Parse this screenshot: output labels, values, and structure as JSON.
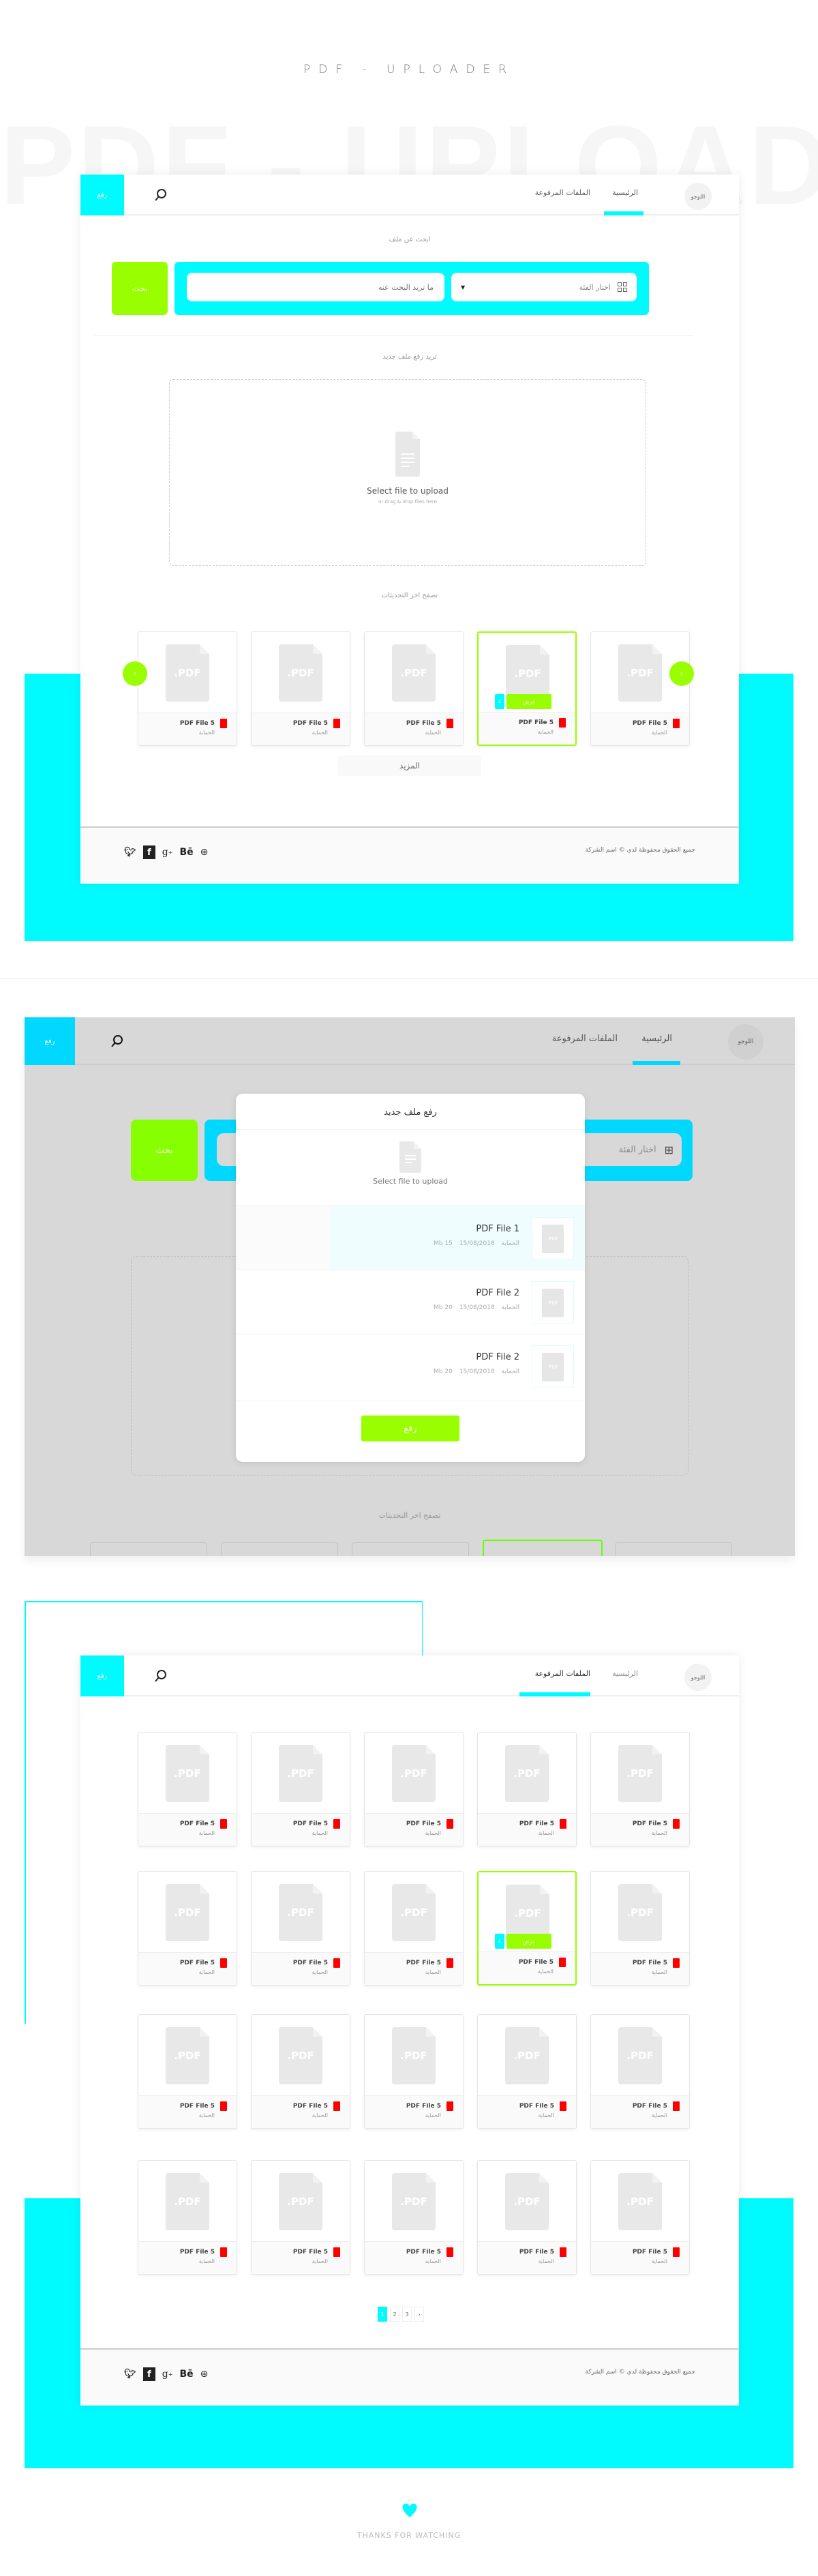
{
  "hero": {
    "title": "PDF - UPLOADER",
    "watermark": "PDF - UPLOADER"
  },
  "colors": {
    "accent_cyan": "#00fbff",
    "accent_green": "#99ff00",
    "pdf_red": "#ff0000",
    "overlay": "#d8d8d8"
  },
  "nav": {
    "upload_label": "رفع",
    "logo_label": "اللوجو",
    "home_label": "الرئيسية",
    "uploaded_label": "الملفات المرفوعة",
    "search_icon": "search-icon"
  },
  "screen1": {
    "search_section_label": "ابحث عن ملف",
    "category_placeholder": "اختار الفئة",
    "search_placeholder": "ما تريد البحث عنه",
    "search_button": "بحث",
    "upload_section_label": "تريد رفع ملف جديد",
    "dropzone_title": "Select file to upload",
    "dropzone_subtitle": "or drag & drop files here",
    "recent_label": "تصفح اخر التحديثات",
    "more_button": "المزيد",
    "cards": [
      {
        "name": "PDF File 5",
        "category": "الحماية",
        "thumb": ".PDF"
      },
      {
        "name": "PDF File 5",
        "category": "الحماية",
        "thumb": ".PDF"
      },
      {
        "name": "PDF File 5",
        "category": "الحماية",
        "thumb": ".PDF"
      },
      {
        "name": "PDF File 5",
        "category": "الحماية",
        "thumb": ".PDF",
        "selected": true
      },
      {
        "name": "PDF File 5",
        "category": "الحماية",
        "thumb": ".PDF"
      }
    ],
    "card_view_label": "عرض",
    "prev_arrow": "‹",
    "next_arrow": "›"
  },
  "footer": {
    "copyright": "جميع الحقوق محفوظة لدي © اسم الشركة",
    "social": [
      "twitter",
      "facebook",
      "google-plus",
      "behance",
      "dribbble"
    ]
  },
  "modal": {
    "title": "رفع ملف جديد",
    "select_label": "Select file to upload",
    "files": [
      {
        "name": "PDF File 1",
        "category": "الحماية",
        "date": "15/08/2018",
        "size": "15 Mb",
        "active": true
      },
      {
        "name": "PDF File 2",
        "category": "الحماية",
        "date": "15/08/2018",
        "size": "20 Mb"
      },
      {
        "name": "PDF File 2",
        "category": "الحماية",
        "date": "15/08/2018",
        "size": "20 Mb"
      }
    ],
    "thumb_label": ".PDF",
    "upload_button": "رفع"
  },
  "screen3": {
    "card_name": "PDF File 5",
    "card_category": "الحماية",
    "pagination": [
      "1",
      "2",
      "3",
      "›"
    ],
    "current_page": "1"
  },
  "thanks": "THANKS FOR WATCHING"
}
